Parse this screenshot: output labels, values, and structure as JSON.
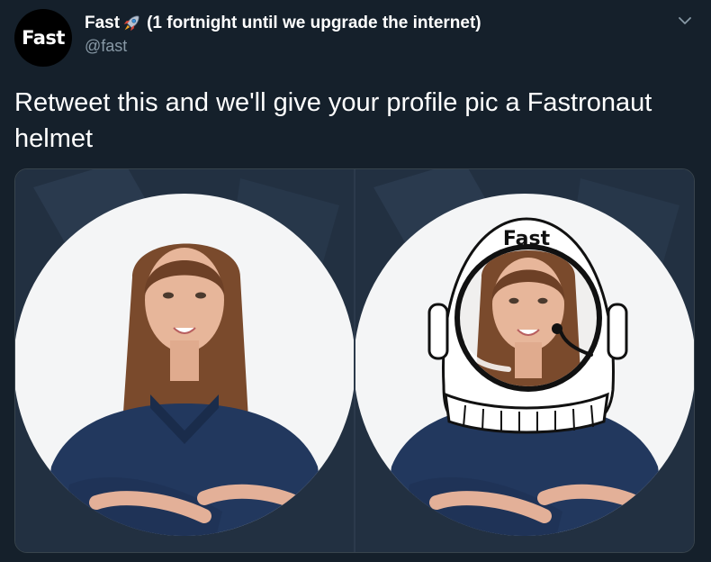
{
  "tweet": {
    "avatar_text": "Fast",
    "display_name": "Fast",
    "name_suffix": "(1 fortnight until we upgrade the internet)",
    "handle": "@fast",
    "text": "Retweet this and we'll give your profile pic a Fastronaut helmet"
  },
  "media": {
    "helmet_label": "Fast"
  },
  "colors": {
    "background": "#15202b",
    "secondary_text": "#8899a6",
    "shirt": "#22385e",
    "hair": "#7a4a2c"
  },
  "icons": {
    "name_emoji": "rocket-icon",
    "menu": "chevron-down-icon"
  }
}
